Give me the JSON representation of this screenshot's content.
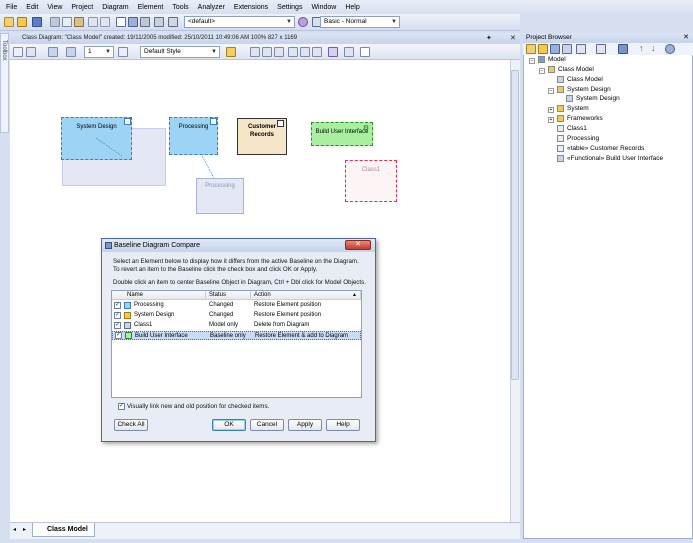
{
  "menu": [
    "File",
    "Edit",
    "View",
    "Project",
    "Diagram",
    "Element",
    "Tools",
    "Analyzer",
    "Extensions",
    "Settings",
    "Window",
    "Help"
  ],
  "toolbar": {
    "perspective_value": "<default>",
    "workspace_value": "Basic - Normal"
  },
  "toolbox_label": "Toolbox",
  "diagram": {
    "title_bar": "Class Diagram: \"Class Model\"   created: 19/11/2005  modified: 25/10/2011 10:49:06 AM   100%   827 x 1169",
    "style_value": "Default Style",
    "font_size_value": "1",
    "tab_label": "Class Model",
    "elements": {
      "system_design": "System Design",
      "processing": "Processing",
      "processing_ghost": "Processing",
      "customer_records": "Customer Records",
      "build_ui": "Build User Interface",
      "class1_ghost": "Class1"
    }
  },
  "project_browser": {
    "title": "Project Browser",
    "tree": [
      {
        "label": "Model",
        "depth": 0
      },
      {
        "label": "Class Model",
        "depth": 1
      },
      {
        "label": "Class Model",
        "depth": 2
      },
      {
        "label": "System Design",
        "depth": 2
      },
      {
        "label": "System Design",
        "depth": 3
      },
      {
        "label": "System",
        "depth": 2
      },
      {
        "label": "Frameworks",
        "depth": 2
      },
      {
        "label": "Class1",
        "depth": 2
      },
      {
        "label": "Processing",
        "depth": 2
      },
      {
        "label": "«table» Customer Records",
        "depth": 2
      },
      {
        "label": "«Functional» Build User Interface",
        "depth": 2
      }
    ]
  },
  "dialog": {
    "title": "Baseline Diagram Compare",
    "instructions": [
      "Select an Element below to display how it differs from the active Baseline on the Diagram.",
      "To revert an item to the Baseline click the check box and click OK or Apply.",
      "Double click an item to center Baseline Object in Diagram, Ctrl + Dbl click for Model Objects."
    ],
    "columns": [
      "Name",
      "Status",
      "Action"
    ],
    "rows": [
      {
        "name": "Processing",
        "status": "Changed",
        "action": "Restore Element position",
        "checked": true,
        "selected": false
      },
      {
        "name": "System Design",
        "status": "Changed",
        "action": "Restore Element position",
        "checked": true,
        "selected": false
      },
      {
        "name": "Class1",
        "status": "Model only",
        "action": "Delete from Diagram",
        "checked": true,
        "selected": false
      },
      {
        "name": "Build User Interface",
        "status": "Baseline only",
        "action": "Restore Element & add to Diagram",
        "checked": true,
        "selected": true
      }
    ],
    "link_checkbox_label": "Visually link new and old position for checked items.",
    "buttons": {
      "check_all": "Check All",
      "ok": "OK",
      "cancel": "Cancel",
      "apply": "Apply",
      "help": "Help"
    }
  },
  "colors": {
    "accent": "#3c7fb1",
    "selection": "#c6dcf7",
    "element_blue": "#9dd3f5",
    "element_green": "#a8f0a0",
    "element_tan": "#f5e6c8"
  }
}
